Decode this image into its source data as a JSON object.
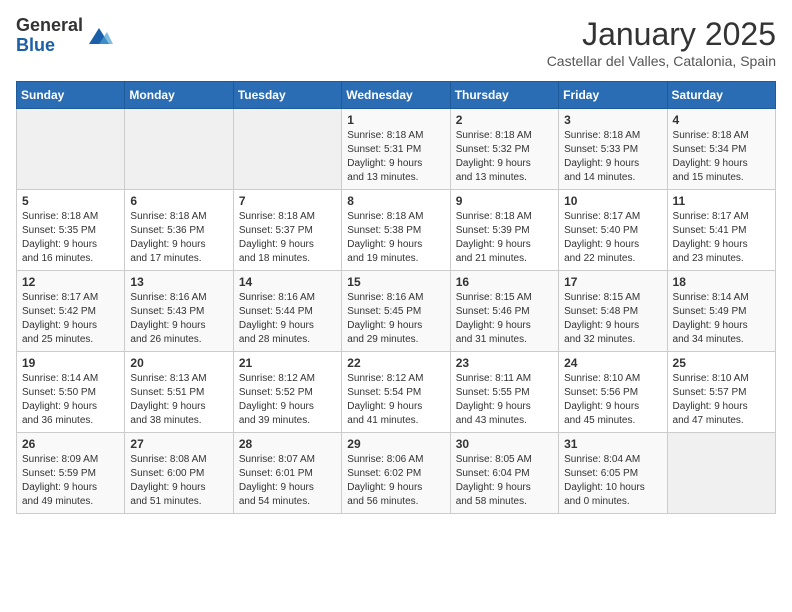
{
  "logo": {
    "general": "General",
    "blue": "Blue"
  },
  "title": "January 2025",
  "location": "Castellar del Valles, Catalonia, Spain",
  "weekdays": [
    "Sunday",
    "Monday",
    "Tuesday",
    "Wednesday",
    "Thursday",
    "Friday",
    "Saturday"
  ],
  "weeks": [
    [
      {
        "day": "",
        "info": ""
      },
      {
        "day": "",
        "info": ""
      },
      {
        "day": "",
        "info": ""
      },
      {
        "day": "1",
        "info": "Sunrise: 8:18 AM\nSunset: 5:31 PM\nDaylight: 9 hours\nand 13 minutes."
      },
      {
        "day": "2",
        "info": "Sunrise: 8:18 AM\nSunset: 5:32 PM\nDaylight: 9 hours\nand 13 minutes."
      },
      {
        "day": "3",
        "info": "Sunrise: 8:18 AM\nSunset: 5:33 PM\nDaylight: 9 hours\nand 14 minutes."
      },
      {
        "day": "4",
        "info": "Sunrise: 8:18 AM\nSunset: 5:34 PM\nDaylight: 9 hours\nand 15 minutes."
      }
    ],
    [
      {
        "day": "5",
        "info": "Sunrise: 8:18 AM\nSunset: 5:35 PM\nDaylight: 9 hours\nand 16 minutes."
      },
      {
        "day": "6",
        "info": "Sunrise: 8:18 AM\nSunset: 5:36 PM\nDaylight: 9 hours\nand 17 minutes."
      },
      {
        "day": "7",
        "info": "Sunrise: 8:18 AM\nSunset: 5:37 PM\nDaylight: 9 hours\nand 18 minutes."
      },
      {
        "day": "8",
        "info": "Sunrise: 8:18 AM\nSunset: 5:38 PM\nDaylight: 9 hours\nand 19 minutes."
      },
      {
        "day": "9",
        "info": "Sunrise: 8:18 AM\nSunset: 5:39 PM\nDaylight: 9 hours\nand 21 minutes."
      },
      {
        "day": "10",
        "info": "Sunrise: 8:17 AM\nSunset: 5:40 PM\nDaylight: 9 hours\nand 22 minutes."
      },
      {
        "day": "11",
        "info": "Sunrise: 8:17 AM\nSunset: 5:41 PM\nDaylight: 9 hours\nand 23 minutes."
      }
    ],
    [
      {
        "day": "12",
        "info": "Sunrise: 8:17 AM\nSunset: 5:42 PM\nDaylight: 9 hours\nand 25 minutes."
      },
      {
        "day": "13",
        "info": "Sunrise: 8:16 AM\nSunset: 5:43 PM\nDaylight: 9 hours\nand 26 minutes."
      },
      {
        "day": "14",
        "info": "Sunrise: 8:16 AM\nSunset: 5:44 PM\nDaylight: 9 hours\nand 28 minutes."
      },
      {
        "day": "15",
        "info": "Sunrise: 8:16 AM\nSunset: 5:45 PM\nDaylight: 9 hours\nand 29 minutes."
      },
      {
        "day": "16",
        "info": "Sunrise: 8:15 AM\nSunset: 5:46 PM\nDaylight: 9 hours\nand 31 minutes."
      },
      {
        "day": "17",
        "info": "Sunrise: 8:15 AM\nSunset: 5:48 PM\nDaylight: 9 hours\nand 32 minutes."
      },
      {
        "day": "18",
        "info": "Sunrise: 8:14 AM\nSunset: 5:49 PM\nDaylight: 9 hours\nand 34 minutes."
      }
    ],
    [
      {
        "day": "19",
        "info": "Sunrise: 8:14 AM\nSunset: 5:50 PM\nDaylight: 9 hours\nand 36 minutes."
      },
      {
        "day": "20",
        "info": "Sunrise: 8:13 AM\nSunset: 5:51 PM\nDaylight: 9 hours\nand 38 minutes."
      },
      {
        "day": "21",
        "info": "Sunrise: 8:12 AM\nSunset: 5:52 PM\nDaylight: 9 hours\nand 39 minutes."
      },
      {
        "day": "22",
        "info": "Sunrise: 8:12 AM\nSunset: 5:54 PM\nDaylight: 9 hours\nand 41 minutes."
      },
      {
        "day": "23",
        "info": "Sunrise: 8:11 AM\nSunset: 5:55 PM\nDaylight: 9 hours\nand 43 minutes."
      },
      {
        "day": "24",
        "info": "Sunrise: 8:10 AM\nSunset: 5:56 PM\nDaylight: 9 hours\nand 45 minutes."
      },
      {
        "day": "25",
        "info": "Sunrise: 8:10 AM\nSunset: 5:57 PM\nDaylight: 9 hours\nand 47 minutes."
      }
    ],
    [
      {
        "day": "26",
        "info": "Sunrise: 8:09 AM\nSunset: 5:59 PM\nDaylight: 9 hours\nand 49 minutes."
      },
      {
        "day": "27",
        "info": "Sunrise: 8:08 AM\nSunset: 6:00 PM\nDaylight: 9 hours\nand 51 minutes."
      },
      {
        "day": "28",
        "info": "Sunrise: 8:07 AM\nSunset: 6:01 PM\nDaylight: 9 hours\nand 54 minutes."
      },
      {
        "day": "29",
        "info": "Sunrise: 8:06 AM\nSunset: 6:02 PM\nDaylight: 9 hours\nand 56 minutes."
      },
      {
        "day": "30",
        "info": "Sunrise: 8:05 AM\nSunset: 6:04 PM\nDaylight: 9 hours\nand 58 minutes."
      },
      {
        "day": "31",
        "info": "Sunrise: 8:04 AM\nSunset: 6:05 PM\nDaylight: 10 hours\nand 0 minutes."
      },
      {
        "day": "",
        "info": ""
      }
    ]
  ]
}
